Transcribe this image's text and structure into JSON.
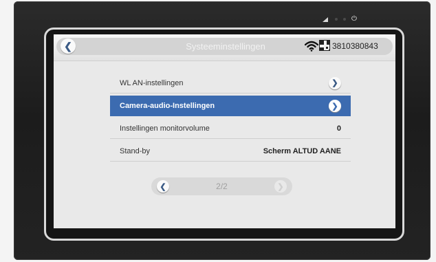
{
  "header": {
    "title": "Systeeminstellingen",
    "device_id": "3810380843",
    "icons": [
      "back-arrow-icon",
      "wifi-icon",
      "qr-code-icon"
    ]
  },
  "menu": {
    "items": [
      {
        "label": "WL AN-instellingen",
        "value": "",
        "selected": false,
        "icon": "chevron-right-icon"
      },
      {
        "label": "Camera-audio-Instellingen",
        "value": "",
        "selected": true,
        "icon": "chevron-right-icon"
      },
      {
        "label": "Instellingen monitorvolume",
        "value": "0",
        "selected": false
      },
      {
        "label": "Stand-by",
        "value": "Scherm ALTUD AANE",
        "selected": false
      }
    ]
  },
  "pager": {
    "page_text": "2/2",
    "icons": [
      "chevron-left-icon",
      "chevron-right-icon"
    ]
  },
  "colors": {
    "selected": "#3c6bb0",
    "indicator": "#f2b51b",
    "chrome": "#1c1c1c"
  }
}
